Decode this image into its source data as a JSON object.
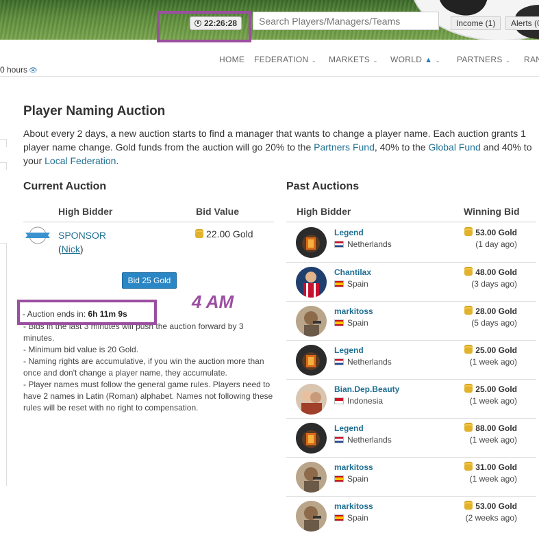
{
  "header": {
    "clock": "22:26:28",
    "search_placeholder": "Search Players/Managers/Teams",
    "income_label": "Income (1)",
    "alerts_label": "Alerts (0"
  },
  "nav": {
    "hours_label": "0 hours",
    "items": [
      {
        "label": "HOME"
      },
      {
        "label": "FEDERATION"
      },
      {
        "label": "MARKETS"
      },
      {
        "label": "WORLD"
      },
      {
        "label": "PARTNERS"
      },
      {
        "label": "RAN"
      }
    ]
  },
  "page": {
    "title": "Player Naming Auction",
    "intro_1": "About every 2 days, a new auction starts to find a manager that wants to change a player name. Each auction grants 1 player name change. Gold funds from the auction will go 20% to the ",
    "partners_fund": "Partners Fund",
    "intro_2": ", 40% to the ",
    "global_fund": "Global Fund",
    "intro_3": " and 40% to your ",
    "local_federation": "Local Federation",
    "intro_4": "."
  },
  "current_auction": {
    "heading": "Current Auction",
    "col_bidder": "High Bidder",
    "col_value": "Bid Value",
    "bidder_name": "SPONSOR",
    "bidder_nick_open": "(",
    "bidder_nick": "Nick",
    "bidder_nick_close": ")",
    "bid_value": "22.00 Gold",
    "bid_button": "Bid 25 Gold",
    "ends_label": "- Auction ends in: ",
    "ends_value": "6h 11m 9s",
    "annotation": "4 AM",
    "rules": [
      "- Bids in the last 3 minutes will push the auction forward by 3 minutes.",
      "- Minimum bid value is 20 Gold.",
      "- Naming rights are accumulative, if you win the auction more than once and don't change a player name, they accumulate.",
      "- Player names must follow the general game rules. Players need to have 2 names in Latin (Roman) alphabet. Names not following these rules will be reset with no right to compensation."
    ]
  },
  "past_auctions": {
    "heading": "Past Auctions",
    "col_bidder": "High Bidder",
    "col_bid": "Winning Bid",
    "rows": [
      {
        "name": "Legend",
        "country": "Netherlands",
        "flag": "nl",
        "gold": "53.00 Gold",
        "ago": "(1 day ago)",
        "avatar": "legend"
      },
      {
        "name": "Chantilax",
        "country": "Spain",
        "flag": "es",
        "gold": "48.00 Gold",
        "ago": "(3 days ago)",
        "avatar": "chantilax"
      },
      {
        "name": "markitoss",
        "country": "Spain",
        "flag": "es",
        "gold": "28.00 Gold",
        "ago": "(5 days ago)",
        "avatar": "markitoss"
      },
      {
        "name": "Legend",
        "country": "Netherlands",
        "flag": "nl",
        "gold": "25.00 Gold",
        "ago": "(1 week ago)",
        "avatar": "legend"
      },
      {
        "name": "Bian.Dep.Beauty",
        "country": "Indonesia",
        "flag": "id",
        "gold": "25.00 Gold",
        "ago": "(1 week ago)",
        "avatar": "bian"
      },
      {
        "name": "Legend",
        "country": "Netherlands",
        "flag": "nl",
        "gold": "88.00 Gold",
        "ago": "(1 week ago)",
        "avatar": "legend"
      },
      {
        "name": "markitoss",
        "country": "Spain",
        "flag": "es",
        "gold": "31.00 Gold",
        "ago": "(1 week ago)",
        "avatar": "markitoss"
      },
      {
        "name": "markitoss",
        "country": "Spain",
        "flag": "es",
        "gold": "53.00 Gold",
        "ago": "(2 weeks ago)",
        "avatar": "markitoss"
      }
    ]
  },
  "colors": {
    "link": "#1f6f93",
    "highlight": "#9b4fa0",
    "button": "#2a86c4"
  }
}
